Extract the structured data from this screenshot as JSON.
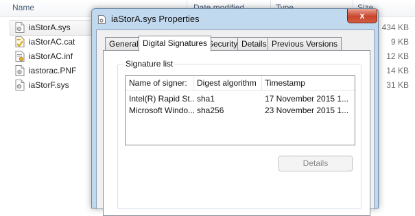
{
  "explorer": {
    "columns": {
      "name": "Name",
      "date_modified": "Date modified",
      "type": "Type",
      "size": "Size"
    },
    "files": [
      {
        "name": "iaStorA.sys",
        "size": "434 KB",
        "icon": "sys-file-icon"
      },
      {
        "name": "iaStorAC.cat",
        "size": "9 KB",
        "icon": "catalog-file-icon"
      },
      {
        "name": "iaStorAC.inf",
        "size": "12 KB",
        "icon": "setup-info-file-icon"
      },
      {
        "name": "iastorac.PNF",
        "size": "14 KB",
        "icon": "pnf-file-icon"
      },
      {
        "name": "iaStorF.sys",
        "size": "31 KB",
        "icon": "sys-file-icon"
      }
    ],
    "selected_index": 0
  },
  "dialog": {
    "title": "iaStorA.sys Properties",
    "close_label": "x",
    "tabs": [
      "General",
      "Digital Signatures",
      "Security",
      "Details",
      "Previous Versions"
    ],
    "active_tab": "Digital Signatures",
    "signature_group_label": "Signature list",
    "list_headers": [
      "Name of signer:",
      "Digest algorithm",
      "Timestamp"
    ],
    "signatures": [
      {
        "signer": "Intel(R) Rapid St...",
        "digest": "sha1",
        "timestamp": "17 November 2015 1..."
      },
      {
        "signer": "Microsoft Windo...",
        "digest": "sha256",
        "timestamp": "23 November 2015 1..."
      }
    ],
    "details_button": "Details"
  },
  "colors": {
    "window_frame": "#c1d9ee",
    "close_button": "#c8452c",
    "column_header_text": "#4c607a"
  }
}
